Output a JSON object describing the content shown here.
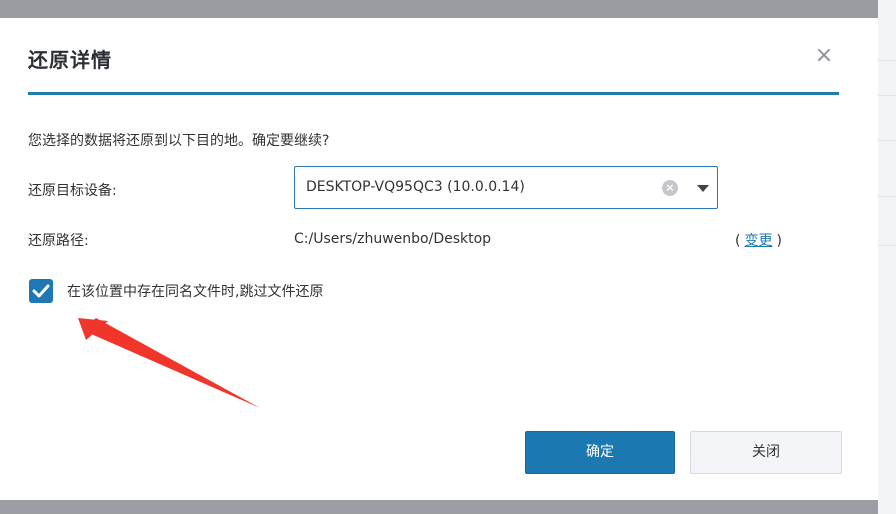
{
  "dialog": {
    "title": "还原详情",
    "close_glyph": "×",
    "prompt": "您选择的数据将还原到以下目的地。确定要继续?",
    "target_device": {
      "label": "还原目标设备:",
      "value": "DESKTOP-VQ95QC3 (10.0.0.14)"
    },
    "restore_path": {
      "label": "还原路径:",
      "value": "C:/Users/zhuwenbo/Desktop",
      "paren_open": "(",
      "change_link": "变更",
      "paren_close": ")"
    },
    "skip_existing": {
      "checked": true,
      "label": "在该位置中存在同名文件时,跳过文件还原"
    },
    "buttons": {
      "ok": "确定",
      "close": "关闭"
    }
  },
  "colors": {
    "accent": "#1f7bb0",
    "annotation_arrow": "#f0362b"
  },
  "icons": {
    "close": "close-icon",
    "clear": "clear-circle-icon",
    "dropdown": "caret-down-icon",
    "checkbox": "checkmark-icon"
  }
}
